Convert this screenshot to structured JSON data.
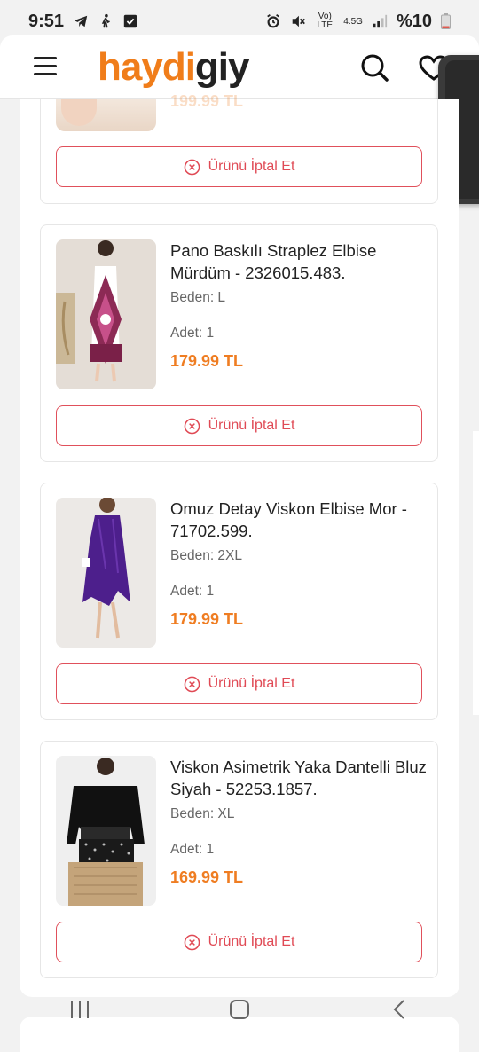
{
  "status_bar": {
    "time": "9:51",
    "network": "Vo) LTE",
    "network_gen": "4.5G",
    "battery": "%10",
    "icons": [
      "telegram-icon",
      "walk-icon",
      "check-icon",
      "alarm-icon",
      "mute-icon",
      "signal-icon",
      "battery-icon"
    ]
  },
  "header": {
    "logo_part1": "haydi",
    "logo_part2": "giy",
    "brand_color": "#f07d1a",
    "icons": [
      "menu-icon",
      "search-icon",
      "heart-icon"
    ]
  },
  "partial_item": {
    "price": "199.99 TL",
    "cancel_label": "Ürünü İptal Et"
  },
  "orders": [
    {
      "name": "Pano Baskılı Straplez Elbise Mürdüm - 2326015.483.",
      "size": "Beden: L",
      "qty": "Adet: 1",
      "price": "179.99 TL",
      "cancel_label": "Ürünü İptal Et"
    },
    {
      "name": "Omuz Detay Viskon Elbise Mor - 71702.599.",
      "size": "Beden: 2XL",
      "qty": "Adet: 1",
      "price": "179.99 TL",
      "cancel_label": "Ürünü İptal Et"
    },
    {
      "name": "Viskon Asimetrik Yaka Dantelli Bluz Siyah - 52253.1857.",
      "size": "Beden: XL",
      "qty": "Adet: 1",
      "price": "169.99 TL",
      "cancel_label": "Ürünü İptal Et"
    }
  ],
  "colors": {
    "price": "#ef7d22",
    "cancel": "#e04a55"
  },
  "nav": [
    "recents-icon",
    "home-icon",
    "back-icon"
  ]
}
